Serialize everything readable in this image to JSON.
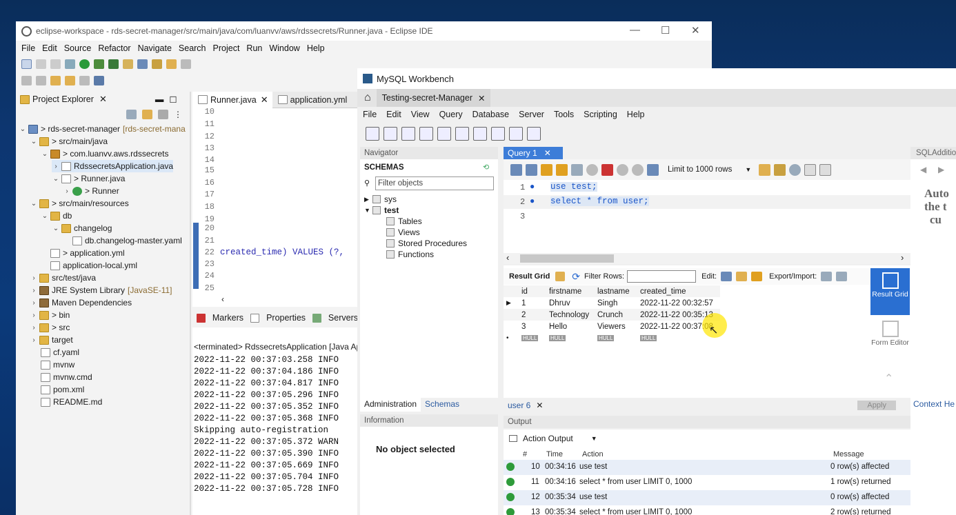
{
  "eclipse": {
    "title": "eclipse-workspace - rds-secret-manager/src/main/java/com/luanvv/aws/rdssecrets/Runner.java - Eclipse IDE",
    "menu": [
      "File",
      "Edit",
      "Source",
      "Refactor",
      "Navigate",
      "Search",
      "Project",
      "Run",
      "Window",
      "Help"
    ],
    "project_explorer": "Project Explorer",
    "tree": {
      "root": "> rds-secret-manager",
      "root_extra": "[rds-secret-mana",
      "src_main_java": "> src/main/java",
      "package": "> com.luanvv.aws.rdssecrets",
      "rds_app": "RdssecretsApplication.java",
      "runner_java": "> Runner.java",
      "runner_class": "> Runner",
      "src_main_res": "> src/main/resources",
      "db": "db",
      "changelog": "changelog",
      "changelog_master": "db.changelog-master.yaml",
      "app_yml": "> application.yml",
      "app_local": "application-local.yml",
      "src_test": "src/test/java",
      "jre": "JRE System Library",
      "jre_extra": "[JavaSE-11]",
      "maven": "Maven Dependencies",
      "bin": "> bin",
      "src": "> src",
      "target": "target",
      "cf": "cf.yaml",
      "mvnw": "mvnw",
      "mvnwcmd": "mvnw.cmd",
      "pom": "pom.xml",
      "readme": "README.md"
    },
    "editor_tabs": [
      "Runner.java",
      "application.yml"
    ],
    "line_numbers": [
      "10",
      "11",
      "12",
      "13",
      "14",
      "15",
      "16",
      "17",
      "18",
      "19",
      "20",
      "21",
      "22",
      "23",
      "24",
      "25"
    ],
    "code_line": "created_time) VALUES (?,",
    "console_tabs": [
      "Markers",
      "Properties",
      "Servers"
    ],
    "console_header": "<terminated> RdssecretsApplication [Java Ap",
    "console_lines": [
      "2022-11-22 00:37:03.258  INFO",
      "2022-11-22 00:37:04.186  INFO",
      "2022-11-22 00:37:04.817  INFO",
      "2022-11-22 00:37:05.296  INFO",
      "2022-11-22 00:37:05.352  INFO",
      "2022-11-22 00:37:05.368  INFO",
      "Skipping auto-registration",
      "2022-11-22 00:37:05.372  WARN",
      "2022-11-22 00:37:05.390  INFO",
      "2022-11-22 00:37:05.669  INFO",
      "2022-11-22 00:37:05.704  INFO",
      "2022-11-22 00:37:05.728  INFO"
    ]
  },
  "workbench": {
    "title": "MySQL Workbench",
    "conn_tab": "Testing-secret-Manager",
    "menu": [
      "File",
      "Edit",
      "View",
      "Query",
      "Database",
      "Server",
      "Tools",
      "Scripting",
      "Help"
    ],
    "navigator": "Navigator",
    "schemas_label": "SCHEMAS",
    "filter_placeholder": "Filter objects",
    "schema_sys": "sys",
    "schema_test": "test",
    "test_children": [
      "Tables",
      "Views",
      "Stored Procedures",
      "Functions"
    ],
    "nav_tabs": [
      "Administration",
      "Schemas"
    ],
    "information": "Information",
    "no_object": "No object selected",
    "query_tab": "Query 1",
    "limit": "Limit to 1000 rows",
    "sql_lines": [
      "use test;",
      "select * from user;"
    ],
    "sql_line_numbers": [
      "1",
      "2",
      "3"
    ],
    "result_grid_label": "Result Grid",
    "filter_rows": "Filter Rows:",
    "edit_label": "Edit:",
    "export_label": "Export/Import:",
    "columns": [
      "id",
      "firstname",
      "lastname",
      "created_time"
    ],
    "rows": [
      [
        "1",
        "Dhruv",
        "Singh",
        "2022-11-22 00:32:57"
      ],
      [
        "2",
        "Technology",
        "Crunch",
        "2022-11-22 00:35:13"
      ],
      [
        "3",
        "Hello",
        "Viewers",
        "2022-11-22 00:37:08"
      ]
    ],
    "null_row": [
      "HULL",
      "HULL",
      "HULL",
      "HULL"
    ],
    "side_result": "Result Grid",
    "side_form": "Form Editor",
    "result_tab": "user 6",
    "apply": "Apply",
    "context_help": "Context He",
    "sql_additions": "SQLAdditio",
    "auto_text": [
      "Auto",
      "the t",
      "cu"
    ],
    "output": "Output",
    "action_output": "Action Output",
    "out_cols": [
      "#",
      "Time",
      "Action",
      "Message"
    ],
    "out_rows": [
      [
        "10",
        "00:34:16",
        "use test",
        "0 row(s) affected"
      ],
      [
        "11",
        "00:34:16",
        "select * from user LIMIT 0, 1000",
        "1 row(s) returned"
      ],
      [
        "12",
        "00:35:34",
        "use test",
        "0 row(s) affected"
      ],
      [
        "13",
        "00:35:34",
        "select * from user LIMIT 0, 1000",
        "2 row(s) returned"
      ]
    ]
  }
}
